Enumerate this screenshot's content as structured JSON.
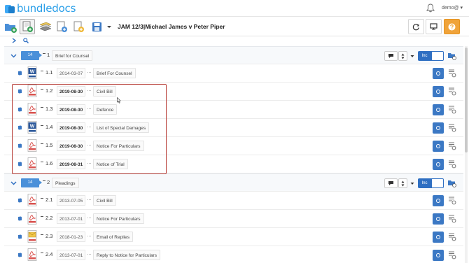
{
  "brand": {
    "name": "bundledocs"
  },
  "user": {
    "name": "demo@ ▾"
  },
  "toolbar": {
    "document_title": "JAM 12/3|Michael James v Peter Piper"
  },
  "sections": [
    {
      "badge": "14",
      "number": "1",
      "label": "Brief for Counsel",
      "inc_label": "Inc",
      "documents": [
        {
          "number": "1.1",
          "date": "2014-03-07",
          "title": "Brief For Counsel",
          "type": "word"
        },
        {
          "number": "1.2",
          "date": "2019-08-30",
          "title": "Civil Bill",
          "type": "pdf"
        },
        {
          "number": "1.3",
          "date": "2019-08-30",
          "title": "Defence",
          "type": "pdf"
        },
        {
          "number": "1.4",
          "date": "2019-08-30",
          "title": "List of Special Damages",
          "type": "word"
        },
        {
          "number": "1.5",
          "date": "2019-08-30",
          "title": "Notice For Particulars",
          "type": "pdf"
        },
        {
          "number": "1.6",
          "date": "2019-08-31",
          "title": "Notice of Trial",
          "type": "pdf"
        }
      ]
    },
    {
      "badge": "14",
      "number": "2",
      "label": "Pleadings",
      "inc_label": "Inc",
      "documents": [
        {
          "number": "2.1",
          "date": "2013-07-05",
          "title": "Civil Bill",
          "type": "pdf"
        },
        {
          "number": "2.2",
          "date": "2013-07-01",
          "title": "Notice For Particulars",
          "type": "pdf"
        },
        {
          "number": "2.3",
          "date": "2018-01-23",
          "title": "Email of Replies",
          "type": "email"
        },
        {
          "number": "2.4",
          "date": "2013-07-01",
          "title": "Reply to Notice for Particulars",
          "type": "pdf"
        }
      ]
    }
  ],
  "colors": {
    "brand": "#2a9fe8",
    "primary": "#3b78c4",
    "accent": "#f0a33a",
    "highlight": "#b8403a",
    "pdf": "#d9534f"
  }
}
